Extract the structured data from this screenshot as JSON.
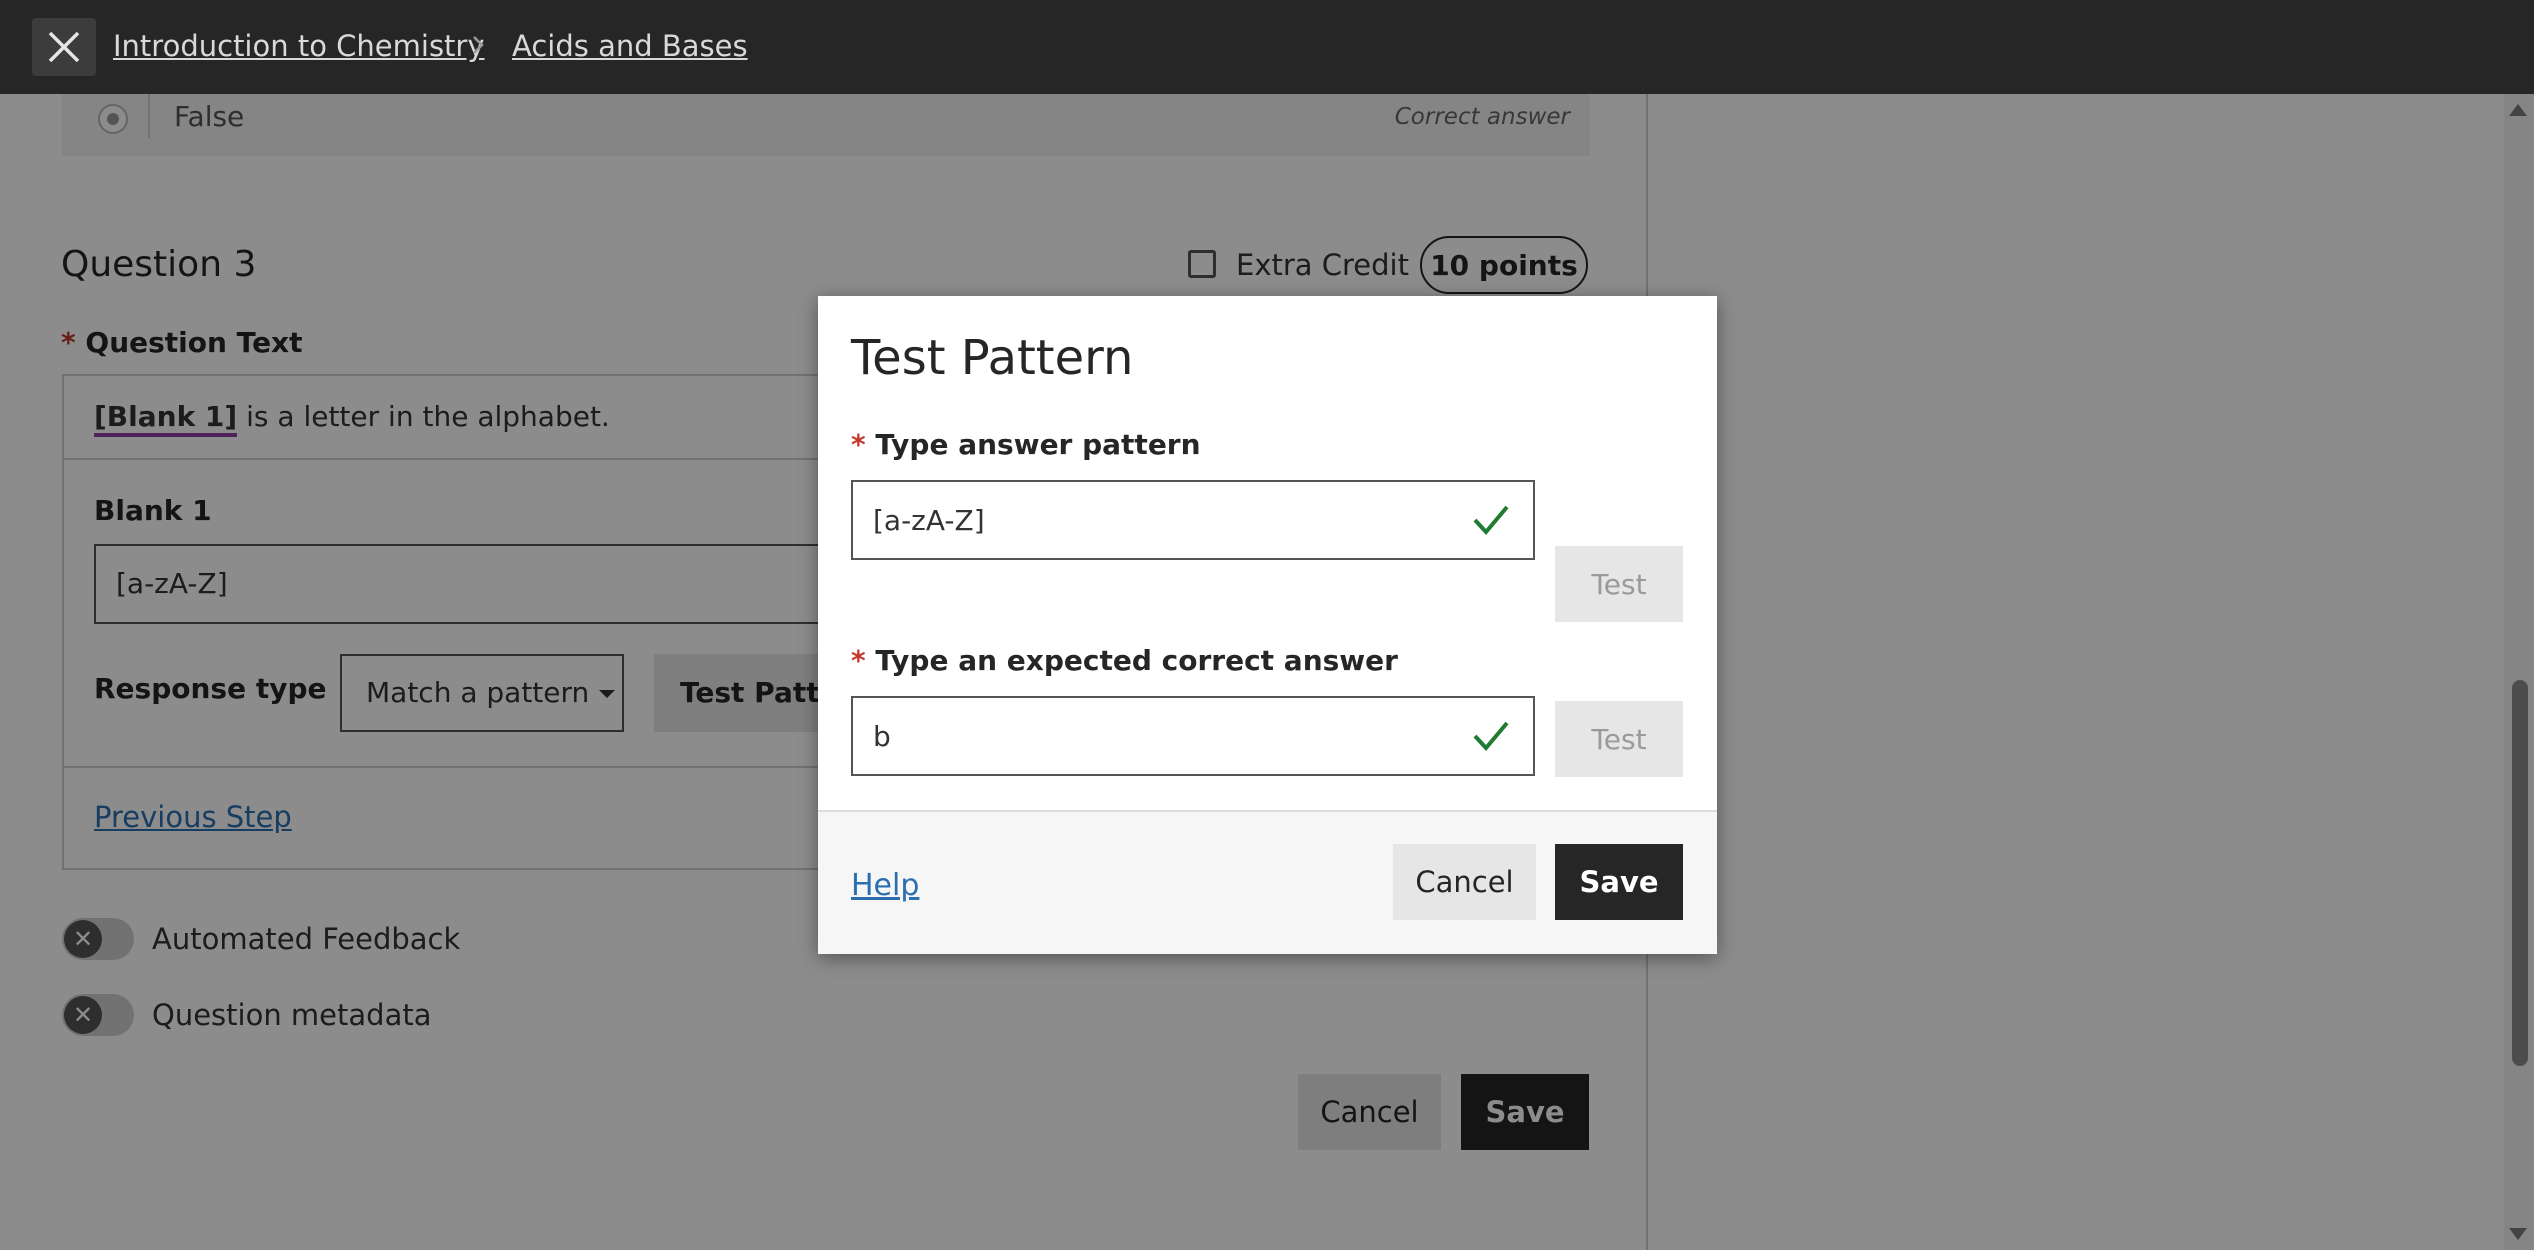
{
  "breadcrumb": {
    "course": "Introduction to Chemistry",
    "section": "Acids and Bases"
  },
  "previous_question": {
    "option_label": "False",
    "correct_label": "Correct answer"
  },
  "question": {
    "title": "Question 3",
    "extra_credit_label": "Extra Credit",
    "points": "10 points",
    "text_label": "Question Text",
    "blank_tag": "[Blank 1]",
    "text_rest": " is a letter in the alphabet.",
    "blank1_label": "Blank 1",
    "blank1_value": "[a-zA-Z]",
    "response_type_label": "Response type",
    "response_type_value": "Match a pattern",
    "test_pattern_label": "Test Pattern",
    "previous_step": "Previous Step",
    "automated_feedback": "Automated Feedback",
    "question_metadata": "Question metadata",
    "cancel": "Cancel",
    "save": "Save"
  },
  "modal": {
    "title": "Test Pattern",
    "pattern_label": "Type answer pattern",
    "pattern_value": "[a-zA-Z]",
    "answer_label": "Type an expected correct answer",
    "answer_value": "b",
    "test_label": "Test",
    "help": "Help",
    "cancel": "Cancel",
    "save": "Save"
  },
  "colors": {
    "required_star": "#c0392b",
    "check": "#1e7d32",
    "link": "#2b6fb0",
    "blank_underline": "#8e3fa0"
  }
}
